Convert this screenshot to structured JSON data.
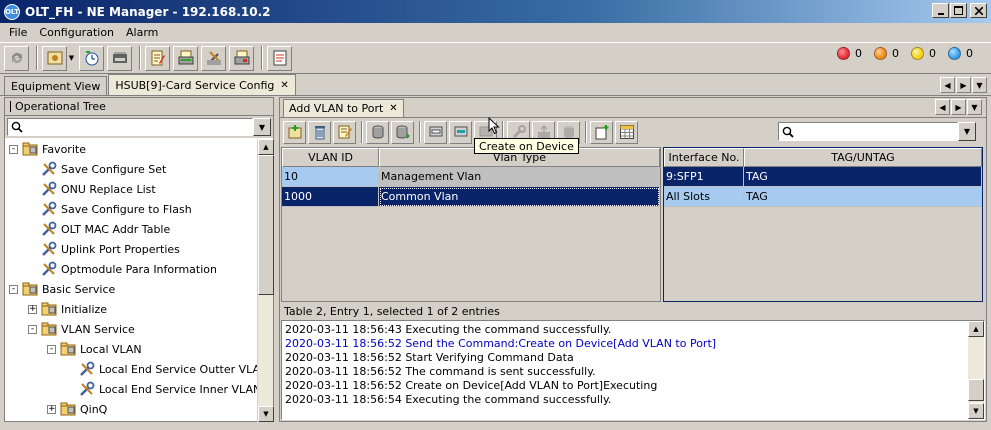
{
  "window": {
    "title": "OLT_FH - NE Manager - 192.168.10.2",
    "icon_text": "OLT"
  },
  "menu": [
    "File",
    "Configuration",
    "Alarm"
  ],
  "alarms": [
    {
      "color": "#e8303a",
      "count": "0"
    },
    {
      "color": "#f08c1e",
      "count": "0"
    },
    {
      "color": "#f2d21c",
      "count": "0"
    },
    {
      "color": "#3a9ee8",
      "count": "0"
    }
  ],
  "tabs": [
    {
      "label": "Equipment View"
    },
    {
      "label": "HSUB[9]-Card Service Config"
    }
  ],
  "left_panel": {
    "header": "Operational Tree",
    "tree": [
      {
        "label": "Favorite",
        "level": 0,
        "expander": "-"
      },
      {
        "label": "Save Configure Set",
        "level": 1,
        "expander": ""
      },
      {
        "label": "ONU Replace List",
        "level": 1,
        "expander": ""
      },
      {
        "label": "Save Configure to Flash",
        "level": 1,
        "expander": ""
      },
      {
        "label": "OLT MAC Addr Table",
        "level": 1,
        "expander": ""
      },
      {
        "label": "Uplink Port Properties",
        "level": 1,
        "expander": ""
      },
      {
        "label": "Optmodule Para Information",
        "level": 1,
        "expander": ""
      },
      {
        "label": "Basic Service",
        "level": 0,
        "expander": "-"
      },
      {
        "label": "Initialize",
        "level": 1,
        "expander": "+"
      },
      {
        "label": "VLAN Service",
        "level": 1,
        "expander": "-"
      },
      {
        "label": "Local VLAN",
        "level": 2,
        "expander": "-"
      },
      {
        "label": "Local End Service Outter VLAN",
        "level": 3,
        "expander": ""
      },
      {
        "label": "Local End Service Inner VLAN",
        "level": 3,
        "expander": ""
      },
      {
        "label": "QinQ",
        "level": 2,
        "expander": "+"
      }
    ]
  },
  "sub_tab": {
    "label": "Add VLAN to Port"
  },
  "tooltip": "Create on Device",
  "vlan_table": {
    "columns": [
      "VLAN ID",
      "Vlan Type"
    ],
    "rows": [
      {
        "vlan_id": "10",
        "vlan_type": "Management Vlan"
      },
      {
        "vlan_id": "1000",
        "vlan_type": "Common Vlan"
      }
    ]
  },
  "interface_table": {
    "columns": [
      "Interface No.",
      "TAG/UNTAG"
    ],
    "rows": [
      {
        "interface": "9:SFP1",
        "tag": "TAG"
      },
      {
        "interface": "All Slots",
        "tag": "TAG"
      }
    ]
  },
  "status": "Table 2, Entry 1, selected 1 of 2 entries",
  "log": [
    {
      "text": "2020-03-11 18:56:43 Executing the command successfully.",
      "color": "#000000"
    },
    {
      "text": "2020-03-11 18:56:52 Send the Command:Create on Device[Add VLAN to Port]",
      "color": "#0000c0"
    },
    {
      "text": "2020-03-11 18:56:52 Start Verifying Command Data",
      "color": "#000000"
    },
    {
      "text": "2020-03-11 18:56:52 The command is sent successfully.",
      "color": "#000000"
    },
    {
      "text": "2020-03-11 18:56:52 Create on Device[Add VLAN to Port]Executing",
      "color": "#000000"
    },
    {
      "text": "2020-03-11 18:56:54 Executing the command successfully.",
      "color": "#000000"
    }
  ]
}
